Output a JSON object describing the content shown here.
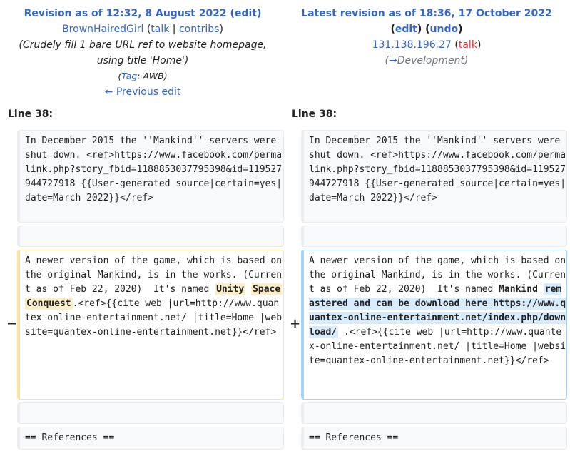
{
  "left_header": {
    "title": "Revision as of 12:32, 8 August 2022",
    "paren_open": " (",
    "edit": "edit",
    "paren_close": ")",
    "user": "BrownHairedGirl",
    "talk": "talk",
    "sep": " | ",
    "contribs": "contribs",
    "summary_line1": "(Crudely fill 1 bare URL ref to website homepage,",
    "summary_line2": "using title 'Home')",
    "tag_open": "(",
    "tag_label": "Tag",
    "tag_colon": ": ",
    "tag_value": "AWB",
    "tag_close": ")",
    "prev_edit": "← Previous edit"
  },
  "right_header": {
    "title": "Latest revision as of 18:36, 17 October 2022",
    "edit": "edit",
    "undo": "undo",
    "ip": "131.138.196.27",
    "talk": "talk",
    "section_arrow": "→",
    "section": "Development"
  },
  "line_left": "Line 38:",
  "line_right": "Line 38:",
  "context1": "In December 2015 the ''Mankind'' servers were shut down. <ref>https://www.facebook.com/permalink.php?story_fbid=1188853037795398&id=119527944727918 {{User-generated source|certain=yes|date=March 2022}}</ref>",
  "left_change": {
    "before": "A newer version of the game, which is based on the original Mankind, is in the works. (Current as of Feb 22, 2020)  It's named ",
    "w1": "Unity",
    "w2": "Space",
    "w3": "Conquest",
    "after": ".<ref>{{cite web |url=http://www.quantex-online-entertainment.net/ |title=Home |website=quantex-online-entertainment.net}}</ref>"
  },
  "right_change": {
    "before": "A newer version of the game, which is based on the original Mankind, is in the works. (Current as of Feb 22, 2020)  It's named ",
    "same": "Mankind",
    "ins": "remastered and can be download here https://www.quantex-online-entertainment.net/index.php/download/",
    "after": ".<ref>{{cite web |url=http://www.quantex-online-entertainment.net/ |title=Home |website=quantex-online-entertainment.net}}</ref>"
  },
  "minus": "−",
  "plus": "+",
  "context2": "== References =="
}
